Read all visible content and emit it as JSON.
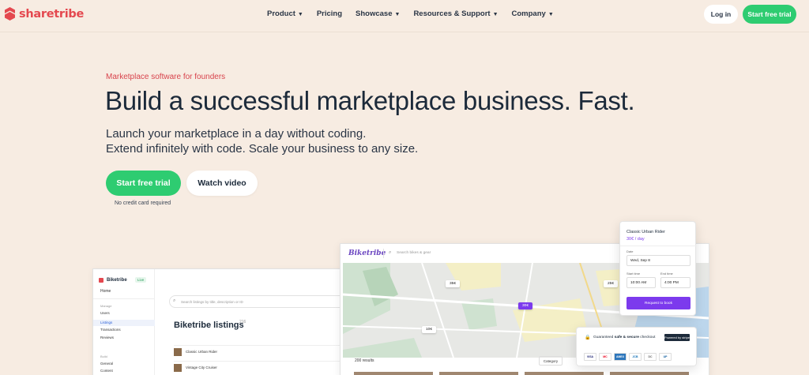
{
  "brand": {
    "name": "sharetribe",
    "color": "#e4484f"
  },
  "nav": {
    "items": [
      {
        "label": "Product",
        "has_caret": true
      },
      {
        "label": "Pricing",
        "has_caret": false
      },
      {
        "label": "Showcase",
        "has_caret": true
      },
      {
        "label": "Resources & Support",
        "has_caret": true
      },
      {
        "label": "Company",
        "has_caret": true
      }
    ],
    "login_label": "Log in",
    "cta_label": "Start free trial"
  },
  "hero": {
    "eyebrow": "Marketplace software for founders",
    "headline": "Build a successful marketplace business. Fast.",
    "subline_1": "Launch your marketplace in a day without coding.",
    "subline_2": "Extend infinitely with code. Scale your business to any size.",
    "primary_button": "Start free trial",
    "secondary_button": "Watch video",
    "note": "No credit card required"
  },
  "colors": {
    "background": "#f7ece2",
    "accent_green": "#2ecc71",
    "accent_red": "#e4484f",
    "accent_purple": "#7c3aed"
  },
  "console": {
    "brand": "Biketribe",
    "live": "Live",
    "home": "Home",
    "section_manage": "Manage",
    "items": [
      "Users",
      "Listings",
      "Transactions",
      "Reviews"
    ],
    "section_build": "Build",
    "build_items": [
      "General",
      "Content"
    ],
    "search_placeholder": "Search listings by title, description or ID",
    "title": "Biketribe listings",
    "count": "216",
    "rows": [
      "Classic Urban Rider",
      "Vintage City Cruiser"
    ]
  },
  "marketplace": {
    "logo": "Biketribe",
    "search_placeholder": "Search bikes & gear",
    "prices": [
      "35€",
      "25€",
      "30€",
      "10€"
    ],
    "results": "200 results",
    "category": "Category"
  },
  "booking": {
    "title": "Classic Urban Rider",
    "price": "30€ / day",
    "date_label": "Date",
    "date_value": "Wed, Sep 8",
    "start_label": "Start time",
    "start_value": "10:00 AM",
    "end_label": "End time",
    "end_value": "4:00 PM",
    "button": "Request to book"
  },
  "checkout": {
    "text_prefix": "Guaranteed ",
    "text_bold": "safe & secure",
    "text_suffix": " checkout",
    "stripe": "Powered by stripe",
    "cards": [
      "VISA",
      "MC",
      "AMEX",
      "JCB",
      "DC",
      "UP"
    ]
  }
}
